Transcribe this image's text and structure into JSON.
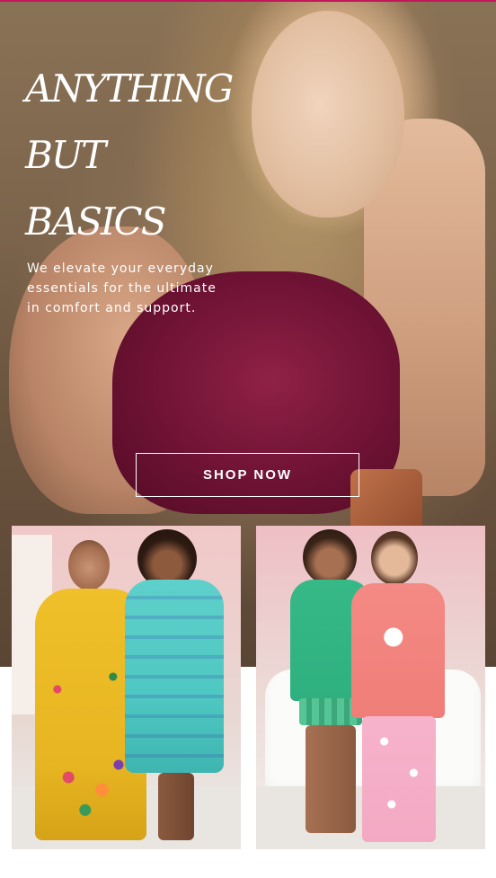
{
  "hero": {
    "title_lines": [
      "ANYTHING",
      "BUT",
      "BASICS"
    ],
    "subtitle_lines": [
      "We elevate your everyday",
      "essentials for the ultimate",
      "in comfort and support."
    ],
    "cta_label": "SHOP NOW"
  },
  "colors": {
    "accent_rule": "#c2185b",
    "bra": "#6e1233",
    "yellow_dress": "#e7b521",
    "aqua_dress": "#4fc7c2",
    "green_top": "#2fb07f",
    "coral_top": "#f07d78",
    "pink_pants": "#f4a9c3"
  },
  "products": [
    {
      "name": "floral-caftan-dresses",
      "icons": [
        "yellow-dress-icon",
        "aqua-dress-icon"
      ]
    },
    {
      "name": "pajama-sets",
      "icons": [
        "green-pajama-icon",
        "coral-pajama-icon"
      ]
    }
  ]
}
